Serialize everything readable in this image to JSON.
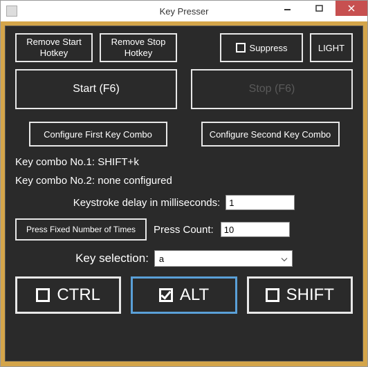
{
  "window": {
    "title": "Key Presser"
  },
  "toolbar": {
    "remove_start": "Remove Start Hotkey",
    "remove_stop": "Remove Stop Hotkey",
    "suppress": "Suppress",
    "light": "LIGHT"
  },
  "main": {
    "start": "Start (F6)",
    "stop": "Stop (F6)"
  },
  "config": {
    "first": "Configure First Key Combo",
    "second": "Configure Second Key Combo"
  },
  "combos": {
    "line1": "Key combo No.1: SHIFT+k",
    "line2": "Key combo No.2: none configured"
  },
  "delay": {
    "label": "Keystroke delay in milliseconds:",
    "value": "1"
  },
  "press": {
    "fixed_btn": "Press Fixed Number of Times",
    "count_label": "Press Count:",
    "count_value": "10"
  },
  "keysel": {
    "label": "Key selection:",
    "value": "a"
  },
  "mods": {
    "ctrl": "CTRL",
    "alt": "ALT",
    "shift": "SHIFT",
    "ctrl_checked": false,
    "alt_checked": true,
    "shift_checked": false
  }
}
